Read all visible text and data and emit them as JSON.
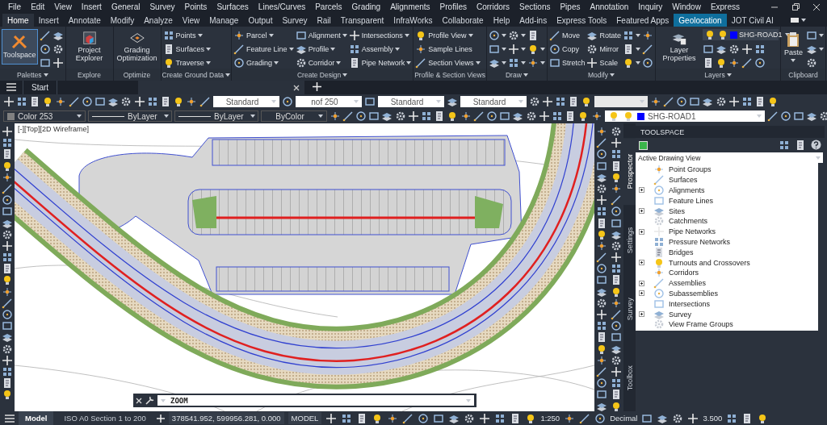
{
  "menu_bar": [
    "File",
    "Edit",
    "View",
    "Insert",
    "General",
    "Survey",
    "Points",
    "Surfaces",
    "Lines/Curves",
    "Parcels",
    "Grading",
    "Alignments",
    "Profiles",
    "Corridors",
    "Sections",
    "Pipes",
    "Annotation",
    "Inquiry",
    "Window",
    "Express"
  ],
  "ribbon_tabs": [
    {
      "label": "Home",
      "selected": true,
      "contextual": false
    },
    {
      "label": "Insert",
      "selected": false,
      "contextual": false
    },
    {
      "label": "Annotate",
      "selected": false,
      "contextual": false
    },
    {
      "label": "Modify",
      "selected": false,
      "contextual": false
    },
    {
      "label": "Analyze",
      "selected": false,
      "contextual": false
    },
    {
      "label": "View",
      "selected": false,
      "contextual": false
    },
    {
      "label": "Manage",
      "selected": false,
      "contextual": false
    },
    {
      "label": "Output",
      "selected": false,
      "contextual": false
    },
    {
      "label": "Survey",
      "selected": false,
      "contextual": false
    },
    {
      "label": "Rail",
      "selected": false,
      "contextual": false
    },
    {
      "label": "Transparent",
      "selected": false,
      "contextual": false
    },
    {
      "label": "InfraWorks",
      "selected": false,
      "contextual": false
    },
    {
      "label": "Collaborate",
      "selected": false,
      "contextual": false
    },
    {
      "label": "Help",
      "selected": false,
      "contextual": false
    },
    {
      "label": "Add-ins",
      "selected": false,
      "contextual": false
    },
    {
      "label": "Express Tools",
      "selected": false,
      "contextual": false
    },
    {
      "label": "Featured Apps",
      "selected": false,
      "contextual": false
    },
    {
      "label": "Geolocation",
      "selected": false,
      "contextual": true
    },
    {
      "label": "JOT Civil AI",
      "selected": false,
      "contextual": false
    }
  ],
  "ribbon_panels": [
    {
      "title": "Palettes",
      "title_dropdown": true,
      "columns": [
        [
          {
            "kind": "large",
            "label": "Toolspace",
            "selected": true,
            "dropdown": false
          }
        ],
        [
          {
            "kind": "icon",
            "dropdown": false
          },
          {
            "kind": "icon",
            "dropdown": false
          },
          {
            "kind": "icon",
            "dropdown": false
          }
        ],
        [
          {
            "kind": "icon",
            "dropdown": false
          },
          {
            "kind": "icon",
            "dropdown": false
          },
          {
            "kind": "icon",
            "dropdown": false
          }
        ]
      ]
    },
    {
      "title": "Explore",
      "title_dropdown": false,
      "columns": [
        [
          {
            "kind": "large",
            "label": "Project Explorer",
            "selected": false,
            "dropdown": false
          }
        ]
      ]
    },
    {
      "title": "Optimize",
      "title_dropdown": false,
      "columns": [
        [
          {
            "kind": "large",
            "label": "Grading Optimization",
            "selected": false,
            "dropdown": false
          }
        ]
      ]
    },
    {
      "title": "Create Ground Data",
      "title_dropdown": true,
      "columns": [
        [
          {
            "kind": "small",
            "label": "Points",
            "dropdown": true
          },
          {
            "kind": "small",
            "label": "Surfaces",
            "dropdown": true
          },
          {
            "kind": "small",
            "label": "Traverse",
            "dropdown": true
          }
        ]
      ]
    },
    {
      "title": "Create Design",
      "title_dropdown": true,
      "columns": [
        [
          {
            "kind": "small",
            "label": "Parcel",
            "dropdown": true
          },
          {
            "kind": "small",
            "label": "Feature Line",
            "dropdown": true
          },
          {
            "kind": "small",
            "label": "Grading",
            "dropdown": true
          }
        ],
        [
          {
            "kind": "small",
            "label": "Alignment",
            "dropdown": true
          },
          {
            "kind": "small",
            "label": "Profile",
            "dropdown": true
          },
          {
            "kind": "small",
            "label": "Corridor",
            "dropdown": true
          }
        ],
        [
          {
            "kind": "small",
            "label": "Intersections",
            "dropdown": true
          },
          {
            "kind": "small",
            "label": "Assembly",
            "dropdown": true
          },
          {
            "kind": "small",
            "label": "Pipe Network",
            "dropdown": true
          }
        ]
      ]
    },
    {
      "title": "Profile & Section Views",
      "title_dropdown": false,
      "columns": [
        [
          {
            "kind": "small",
            "label": "Profile View",
            "dropdown": true
          },
          {
            "kind": "small",
            "label": "Sample Lines",
            "dropdown": false
          },
          {
            "kind": "small",
            "label": "Section Views",
            "dropdown": true
          }
        ]
      ]
    },
    {
      "title": "Draw",
      "title_dropdown": true,
      "columns": [
        [
          {
            "kind": "icon",
            "dropdown": true
          },
          {
            "kind": "icon",
            "dropdown": true
          },
          {
            "kind": "icon",
            "dropdown": true
          }
        ],
        [
          {
            "kind": "icon",
            "dropdown": true
          },
          {
            "kind": "icon",
            "dropdown": true
          },
          {
            "kind": "icon",
            "dropdown": true
          }
        ],
        [
          {
            "kind": "icon",
            "dropdown": false
          },
          {
            "kind": "icon",
            "dropdown": true
          },
          {
            "kind": "icon",
            "dropdown": true
          }
        ]
      ]
    },
    {
      "title": "Modify",
      "title_dropdown": true,
      "columns": [
        [
          {
            "kind": "small",
            "label": "Move",
            "dropdown": false
          },
          {
            "kind": "small",
            "label": "Copy",
            "dropdown": false
          },
          {
            "kind": "small",
            "label": "Stretch",
            "dropdown": false
          }
        ],
        [
          {
            "kind": "small",
            "label": "Rotate",
            "dropdown": false
          },
          {
            "kind": "small",
            "label": "Mirror",
            "dropdown": false
          },
          {
            "kind": "small",
            "label": "Scale",
            "dropdown": false
          }
        ],
        [
          {
            "kind": "icon",
            "dropdown": true
          },
          {
            "kind": "icon",
            "dropdown": true
          },
          {
            "kind": "icon",
            "dropdown": true
          }
        ],
        [
          {
            "kind": "icon",
            "dropdown": false
          },
          {
            "kind": "icon",
            "dropdown": false
          },
          {
            "kind": "icon",
            "dropdown": false
          }
        ]
      ]
    },
    {
      "title": "Layers",
      "title_dropdown": true,
      "columns": [
        [
          {
            "kind": "large",
            "label": "Layer Properties",
            "selected": false,
            "dropdown": false
          }
        ],
        [
          {
            "kind": "layer_combo",
            "value": "SHG-ROAD1",
            "color": "#0000ff"
          },
          {
            "kind": "icon_strip"
          },
          {
            "kind": "icon_strip"
          }
        ]
      ]
    },
    {
      "title": "Clipboard",
      "title_dropdown": false,
      "columns": [
        [
          {
            "kind": "large",
            "label": "Paste",
            "selected": false,
            "dropdown": true
          }
        ],
        [
          {
            "kind": "icon",
            "dropdown": true
          },
          {
            "kind": "icon",
            "dropdown": true
          },
          {
            "kind": "icon",
            "dropdown": false
          }
        ]
      ]
    }
  ],
  "file_tabs": [
    {
      "label": "Start",
      "selected": false
    }
  ],
  "toolbar_rows": [
    {
      "items": [
        {
          "kind": "icon_strip"
        },
        {
          "kind": "icon_strip"
        },
        {
          "kind": "icon_strip"
        },
        {
          "kind": "icon"
        },
        {
          "kind": "combo",
          "value": "Standard"
        },
        {
          "kind": "icon"
        },
        {
          "kind": "combo",
          "value": "nof 250"
        },
        {
          "kind": "icon"
        },
        {
          "kind": "combo",
          "value": "Standard"
        },
        {
          "kind": "icon"
        },
        {
          "kind": "combo",
          "value": "Standard"
        },
        {
          "kind": "icon_strip"
        },
        {
          "kind": "empty_combo"
        },
        {
          "kind": "icon_strip"
        },
        {
          "kind": "icon_strip"
        }
      ]
    },
    {
      "items": [
        {
          "kind": "color_combo",
          "value": "Color 253",
          "color": "#808080"
        },
        {
          "kind": "line_combo",
          "value": "ByLayer"
        },
        {
          "kind": "line_combo",
          "value": "ByLayer"
        },
        {
          "kind": "combo",
          "value": "ByColor"
        },
        {
          "kind": "icon_strip"
        },
        {
          "kind": "icon_strip"
        },
        {
          "kind": "icon_strip"
        },
        {
          "kind": "icon_strip"
        },
        {
          "kind": "icon"
        },
        {
          "kind": "layer_combo",
          "value": "SHG-ROAD1",
          "color": "#0000ff"
        },
        {
          "kind": "icon_strip"
        }
      ]
    }
  ],
  "viewport": {
    "label": "[-][Top][2D Wireframe]"
  },
  "command_line": {
    "value": "ZOOM"
  },
  "toolspace": {
    "title": "TOOLSPACE",
    "view": "Active Drawing View",
    "side_tabs": [
      {
        "label": "Prospector",
        "selected": true
      },
      {
        "label": "Settings",
        "selected": false
      },
      {
        "label": "Survey",
        "selected": false
      },
      {
        "label": "Toolbox",
        "selected": false
      }
    ],
    "tree": [
      {
        "label": "Point Groups",
        "expandable": false
      },
      {
        "label": "Surfaces",
        "expandable": false
      },
      {
        "label": "Alignments",
        "expandable": true
      },
      {
        "label": "Feature Lines",
        "expandable": false
      },
      {
        "label": "Sites",
        "expandable": true
      },
      {
        "label": "Catchments",
        "expandable": false
      },
      {
        "label": "Pipe Networks",
        "expandable": true
      },
      {
        "label": "Pressure Networks",
        "expandable": false
      },
      {
        "label": "Bridges",
        "expandable": false
      },
      {
        "label": "Turnouts and Crossovers",
        "expandable": true
      },
      {
        "label": "Corridors",
        "expandable": false
      },
      {
        "label": "Assemblies",
        "expandable": true
      },
      {
        "label": "Subassemblies",
        "expandable": true
      },
      {
        "label": "Intersections",
        "expandable": false
      },
      {
        "label": "Survey",
        "expandable": true
      },
      {
        "label": "View Frame Groups",
        "expandable": false
      }
    ]
  },
  "status_bar": {
    "layout_tabs": [
      {
        "label": "Model",
        "selected": true
      },
      {
        "label": "ISO A0 Section 1 to 200",
        "selected": false
      }
    ],
    "coordinates": "378541.952, 599956.281, 0.000",
    "space": "MODEL",
    "scale": "1:250",
    "units": "Decimal",
    "value": "3.500"
  }
}
